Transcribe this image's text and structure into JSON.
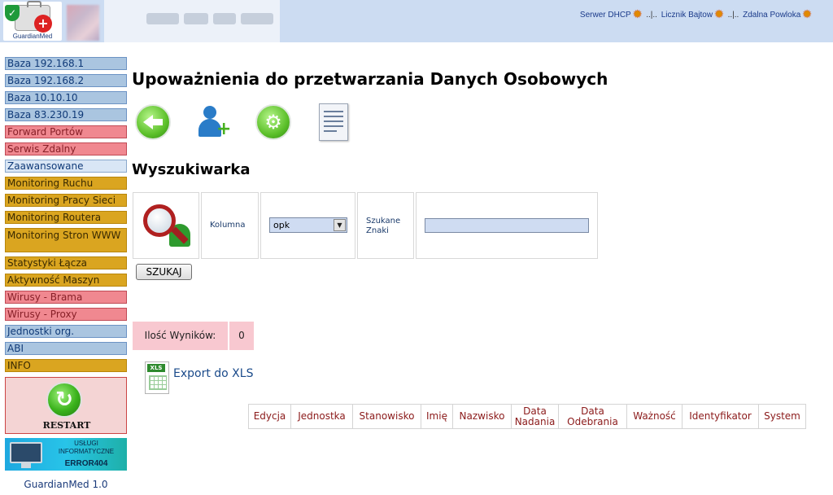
{
  "header": {
    "logo_text": "GuardianMed",
    "links": [
      {
        "label": "Serwer DHCP"
      },
      {
        "label": "Licznik Bajtow"
      },
      {
        "label": "Zdalna Powloka"
      }
    ],
    "separator": "..|..",
    "link_icon": "sun-icon"
  },
  "sidebar": {
    "items": [
      {
        "label": "Baza 192.168.1",
        "color": "blue"
      },
      {
        "label": "Baza 192.168.2",
        "color": "blue"
      },
      {
        "label": "Baza 10.10.10",
        "color": "blue"
      },
      {
        "label": "Baza 83.230.19",
        "color": "blue"
      },
      {
        "label": "Forward Portów",
        "color": "red"
      },
      {
        "label": "Serwis Zdalny",
        "color": "red"
      },
      {
        "label": "Zaawansowane",
        "color": "lightblue"
      },
      {
        "label": "Monitoring Ruchu",
        "color": "gold"
      },
      {
        "label": "Monitoring Pracy Sieci",
        "color": "gold"
      },
      {
        "label": "Monitoring Routera",
        "color": "gold"
      },
      {
        "label": "Monitoring Stron WWW",
        "color": "gold"
      },
      {
        "label": "Statystyki Łącza",
        "color": "gold"
      },
      {
        "label": "Aktywność Maszyn",
        "color": "gold"
      },
      {
        "label": "Wirusy - Brama",
        "color": "red"
      },
      {
        "label": "Wirusy - Proxy",
        "color": "red"
      },
      {
        "label": "Jednostki org.",
        "color": "blue"
      },
      {
        "label": "ABI",
        "color": "blue"
      },
      {
        "label": "INFO",
        "color": "gold"
      }
    ],
    "restart_label": "RESTART",
    "banner_line1": "USŁUGI INFORMATYCZNE",
    "banner_line2": "ERROR404",
    "version": "GuardianMed 1.0"
  },
  "main": {
    "title": "Upoważnienia do przetwarzania Danych Osobowych",
    "toolbar_icons": [
      "back-arrow-icon",
      "add-user-icon",
      "settings-gear-icon",
      "document-icon"
    ],
    "search_title": "Wyszukiwarka",
    "column_label": "Kolumna",
    "column_value": "opk",
    "search_label": "Szukane Znaki",
    "search_value": "",
    "search_button": "SZUKAJ",
    "results_label": "Ilość Wyników:",
    "results_count": "0",
    "export_label": "Export do XLS",
    "export_icon_tag": "XLS",
    "table_headers": [
      "Edycja",
      "Jednostka",
      "Stanowisko",
      "Imię",
      "Nazwisko",
      "Data Nadania",
      "Data Odebrania",
      "Ważność",
      "Identyfikator",
      "System"
    ]
  },
  "colors": {
    "header_bg": "#ccdcf2",
    "nav_blue": "#aac5e0",
    "nav_red": "#f08890",
    "nav_gold": "#daa520",
    "results_bg": "#f8c8d0",
    "table_header_text": "#8b1a1a"
  }
}
